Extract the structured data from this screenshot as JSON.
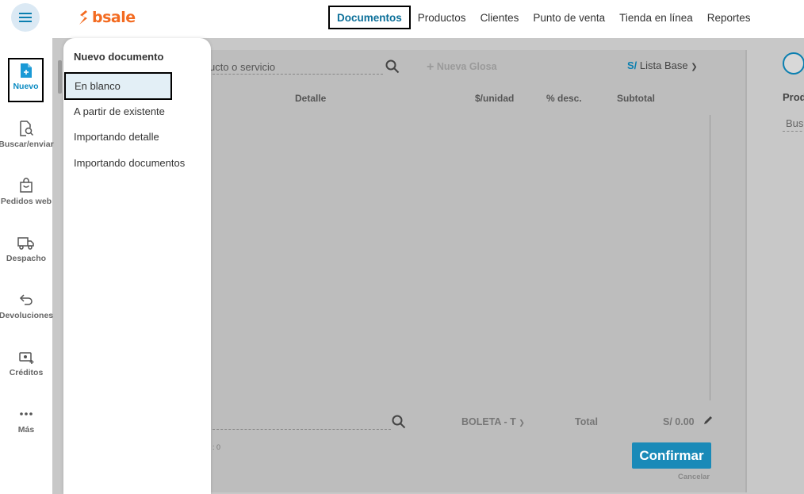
{
  "topbar": {
    "menu_icon": "hamburger-icon",
    "logo_text": "bsale",
    "nav": [
      "Documentos",
      "Productos",
      "Clientes",
      "Punto de venta",
      "Tienda en línea",
      "Reportes"
    ],
    "active_nav": "Documentos"
  },
  "sidebar": {
    "items": [
      {
        "label": "Nuevo",
        "icon": "new-document-icon",
        "active": true
      },
      {
        "label": "Buscar/enviar",
        "icon": "search-document-icon"
      },
      {
        "label": "Pedidos web",
        "icon": "shopping-bag-icon"
      },
      {
        "label": "Despacho",
        "icon": "truck-icon"
      },
      {
        "label": "Devoluciones",
        "icon": "return-arrow-icon"
      },
      {
        "label": "Créditos",
        "icon": "money-plus-icon"
      },
      {
        "label": "Más",
        "icon": "more-dots-icon"
      }
    ]
  },
  "dropdown": {
    "title": "Nuevo documento",
    "options": [
      "En blanco",
      "A partir de existente",
      "Importando detalle",
      "Importando documentos"
    ],
    "selected": "En blanco"
  },
  "sheet": {
    "search_text": "ucto o servicio",
    "nueva_glosa": "Nueva Glosa",
    "currency": "S/",
    "price_list": "Lista Base",
    "columns": [
      "Detalle",
      "$/unidad",
      "% desc.",
      "Subtotal"
    ],
    "doc_type": "BOLETA - T",
    "total_label": "Total",
    "total_value": "S/ 0.00",
    "small_value": ": 0",
    "confirm_label": "Confirmar",
    "cancel_label": "Cancelar"
  },
  "right_panel": {
    "heading": "Prod",
    "search_text": "Busc"
  },
  "colors": {
    "accent": "#0b7fb0",
    "brand": "#f36b21",
    "confirm": "#1a8ab8"
  }
}
